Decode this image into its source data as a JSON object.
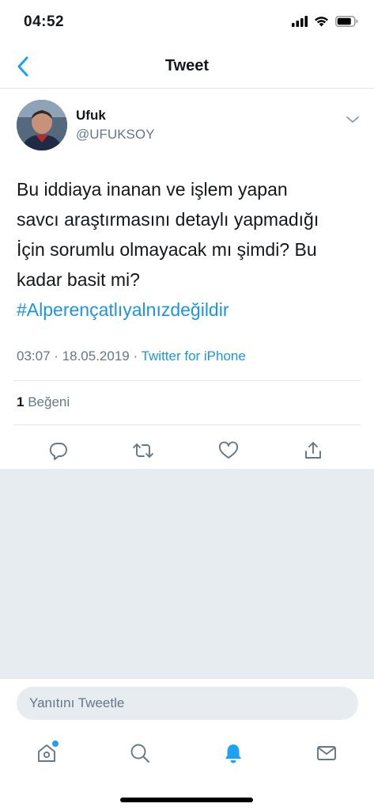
{
  "status_bar": {
    "time": "04:52"
  },
  "nav": {
    "title": "Tweet"
  },
  "tweet": {
    "author_name": "Ufuk",
    "author_handle": "@UFUKSOY",
    "text_lines": [
      "Bu iddiaya inanan ve işlem yapan",
      "savcı araştırmasını detaylı yapmadığı",
      "İçin sorumlu olmayacak mı şimdi? Bu",
      "kadar basit mi?"
    ],
    "hashtag": "#Alperençatlıyalnızdeğildir",
    "time": "03:07",
    "separator": " · ",
    "date": "18.05.2019",
    "source": "Twitter for iPhone",
    "like_count": "1",
    "like_label": "Beğeni"
  },
  "reply": {
    "placeholder": "Yanıtını Tweetle"
  },
  "colors": {
    "accent": "#1da1f2",
    "link": "#1b95e0",
    "muted": "#657786",
    "background_gray": "#e6ecf0"
  },
  "icons": {
    "actions": [
      "reply-icon",
      "retweet-icon",
      "like-icon",
      "share-icon"
    ],
    "tabs": [
      "home-icon",
      "search-icon",
      "notifications-icon",
      "messages-icon"
    ]
  }
}
